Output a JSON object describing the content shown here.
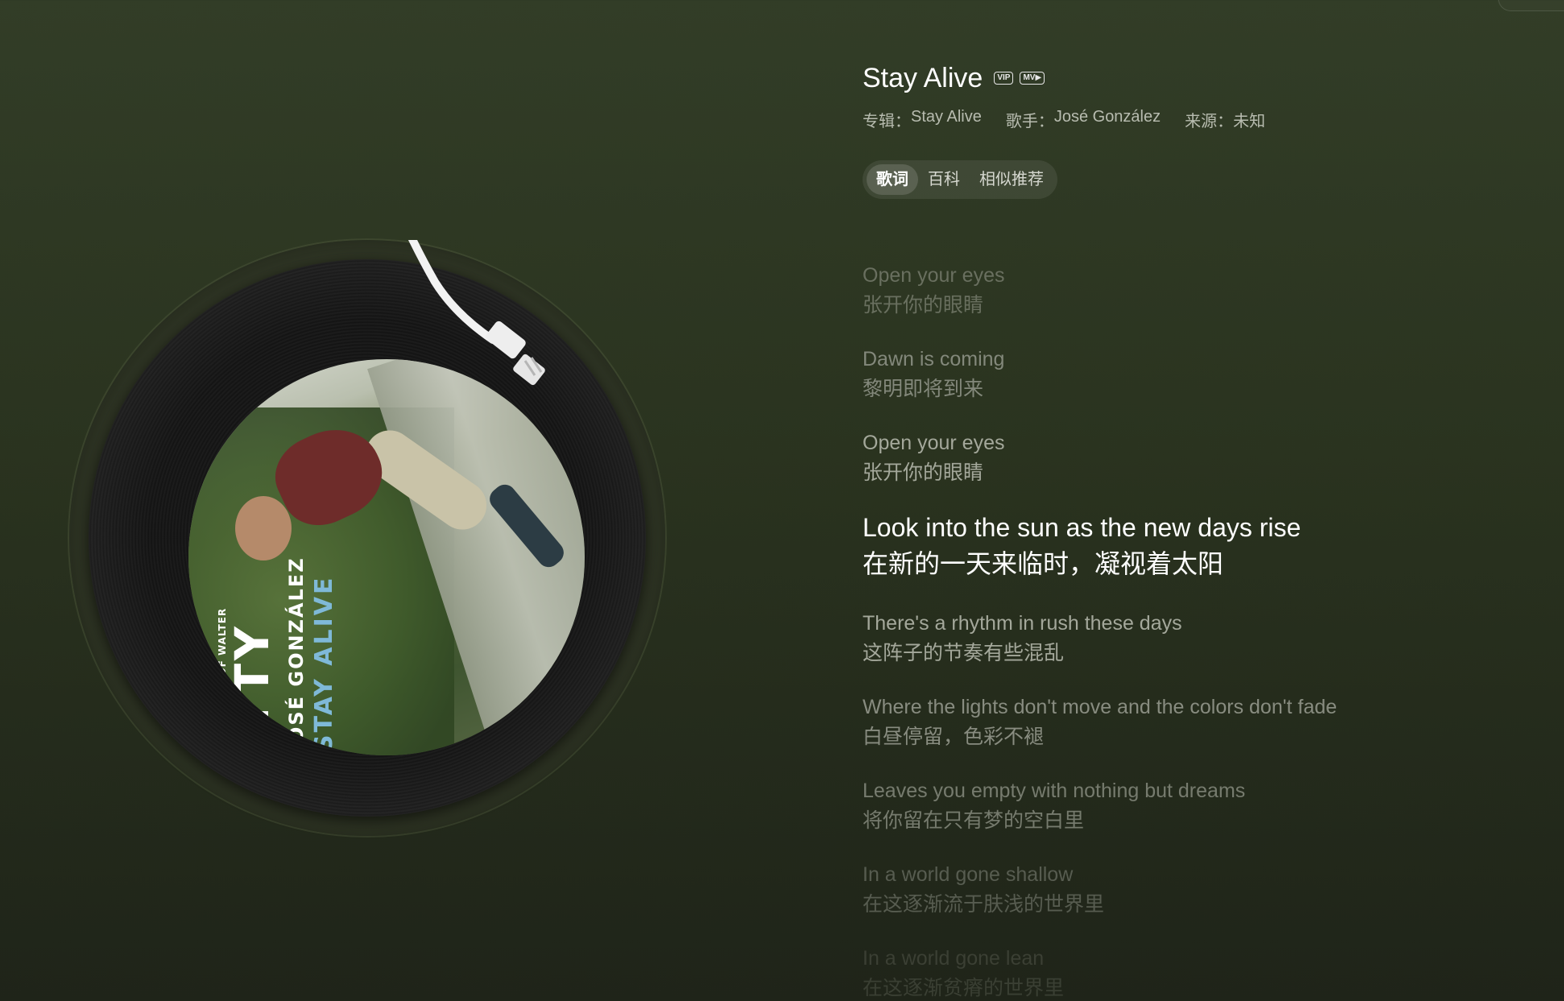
{
  "song": {
    "title": "Stay Alive",
    "badges": [
      "VIP",
      "MV▶"
    ],
    "album_label": "专辑：",
    "album": "Stay Alive",
    "singer_label": "歌手：",
    "singer": "José González",
    "source_label": "来源：",
    "source": "未知"
  },
  "tabs": [
    {
      "label": "歌词",
      "active": true
    },
    {
      "label": "百科",
      "active": false
    },
    {
      "label": "相似推荐",
      "active": false
    }
  ],
  "cover_text": {
    "walter": "E OF WALTER",
    "itty": "ITTY",
    "artist": "JOSÉ GONZÁLEZ",
    "album": "STAY ALIVE"
  },
  "lyrics": [
    {
      "en": "Open your eyes",
      "zh": "张开你的眼睛"
    },
    {
      "en": "Dawn is coming",
      "zh": "黎明即将到来"
    },
    {
      "en": "Open your eyes",
      "zh": "张开你的眼睛"
    },
    {
      "en": "Look into the sun as the new days rise",
      "zh": "在新的一天来临时，凝视着太阳",
      "current": true
    },
    {
      "en": "There's a rhythm in rush these days",
      "zh": "这阵子的节奏有些混乱"
    },
    {
      "en": "Where the lights don't move and the colors don't fade",
      "zh": "白昼停留，色彩不褪"
    },
    {
      "en": "Leaves you empty with nothing but dreams",
      "zh": "将你留在只有梦的空白里"
    },
    {
      "en": "In a world gone shallow",
      "zh": "在这逐渐流于肤浅的世界里"
    },
    {
      "en": "In a world gone lean",
      "zh": "在这逐渐贫瘠的世界里"
    }
  ],
  "colors": {
    "bg_top": "#323d27",
    "bg_bottom": "#1f2419",
    "current_lyric": "#ffffff",
    "dim_lyric": "#9a9e92"
  }
}
